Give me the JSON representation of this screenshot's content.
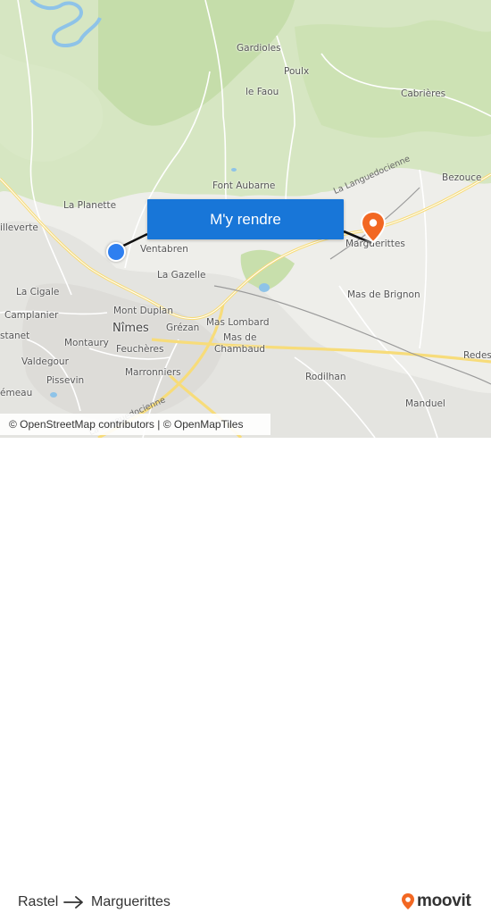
{
  "map": {
    "places": [
      {
        "name": "Gardioles",
        "cls": ""
      },
      {
        "name": "Poulx",
        "cls": ""
      },
      {
        "name": "le Faou",
        "cls": ""
      },
      {
        "name": "Cabrières",
        "cls": ""
      },
      {
        "name": "Bezouce",
        "cls": ""
      },
      {
        "name": "Font Aubarne",
        "cls": ""
      },
      {
        "name": "La Planette",
        "cls": ""
      },
      {
        "name": "illeverte",
        "cls": ""
      },
      {
        "name": "Ventabren",
        "cls": ""
      },
      {
        "name": "La Gazelle",
        "cls": ""
      },
      {
        "name": "Marguerittes",
        "cls": ""
      },
      {
        "name": "Mas de Brignon",
        "cls": ""
      },
      {
        "name": "La Cigale",
        "cls": ""
      },
      {
        "name": "Camplanier",
        "cls": ""
      },
      {
        "name": "Mont Duplan",
        "cls": ""
      },
      {
        "name": "Nîmes",
        "cls": "city"
      },
      {
        "name": "Mas Lombard",
        "cls": ""
      },
      {
        "name": "Grézan",
        "cls": ""
      },
      {
        "name": "stanet",
        "cls": ""
      },
      {
        "name": "Montaury",
        "cls": ""
      },
      {
        "name": "Feuchères",
        "cls": ""
      },
      {
        "name": "Mas de",
        "cls": ""
      },
      {
        "name": "Chambaud",
        "cls": ""
      },
      {
        "name": "Valdegour",
        "cls": ""
      },
      {
        "name": "Marronniers",
        "cls": ""
      },
      {
        "name": "Redess",
        "cls": ""
      },
      {
        "name": "Pissevin",
        "cls": ""
      },
      {
        "name": "Rodilhan",
        "cls": ""
      },
      {
        "name": "émeau",
        "cls": ""
      },
      {
        "name": "Manduel",
        "cls": ""
      }
    ],
    "road_labels": [
      "La Languedocienne",
      "La Languedocienne"
    ],
    "cta_label": "M'y rendre",
    "attribution": "© OpenStreetMap contributors | © OpenMapTiles",
    "colors": {
      "water": "#8ec3e8",
      "forest": "#c9dfb0",
      "route": "#111111",
      "cta": "#1876d8",
      "origin": "#2e7ff0",
      "destination": "#f26722"
    }
  },
  "footer": {
    "from": "Rastel",
    "to": "Marguerittes",
    "logo_text": "moovit",
    "logo_color": "#f26722"
  }
}
